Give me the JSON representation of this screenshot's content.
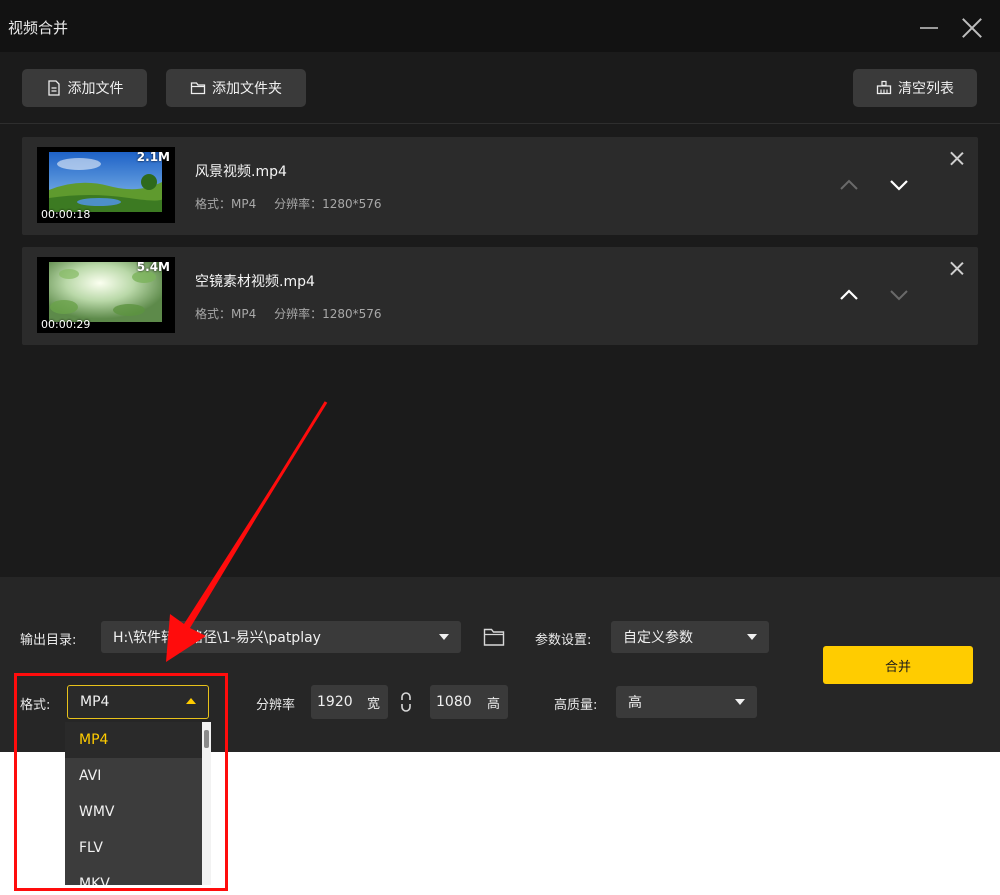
{
  "window": {
    "title": "视频合并"
  },
  "toolbar": {
    "add_file_label": "添加文件",
    "add_folder_label": "添加文件夹",
    "clear_list_label": "清空列表"
  },
  "files": [
    {
      "name": "风景视频.mp4",
      "format_label": "格式：MP4",
      "resolution_label": "分辨率：1280*576",
      "size": "2.1M",
      "duration": "00:00:18",
      "up_enabled": false,
      "down_enabled": true
    },
    {
      "name": "空镜素材视频.mp4",
      "format_label": "格式：MP4",
      "resolution_label": "分辨率：1280*576",
      "size": "5.4M",
      "duration": "00:00:29",
      "up_enabled": true,
      "down_enabled": false
    }
  ],
  "output": {
    "dir_label": "输出目录:",
    "dir_value": "H:\\软件转换路径\\1-易兴\\patplay",
    "params_label": "参数设置:",
    "params_value": "自定义参数"
  },
  "format": {
    "label": "格式:",
    "value": "MP4",
    "options": [
      "MP4",
      "AVI",
      "WMV",
      "FLV",
      "MKV"
    ]
  },
  "resolution": {
    "label": "分辨率",
    "width": "1920",
    "width_unit": "宽",
    "height": "1080",
    "height_unit": "高"
  },
  "quality": {
    "label": "高质量:",
    "value": "高"
  },
  "merge_label": "合并",
  "colors": {
    "accent": "#ffcc00",
    "annotation": "#ff0c0c",
    "background": "#1b1b1b"
  }
}
